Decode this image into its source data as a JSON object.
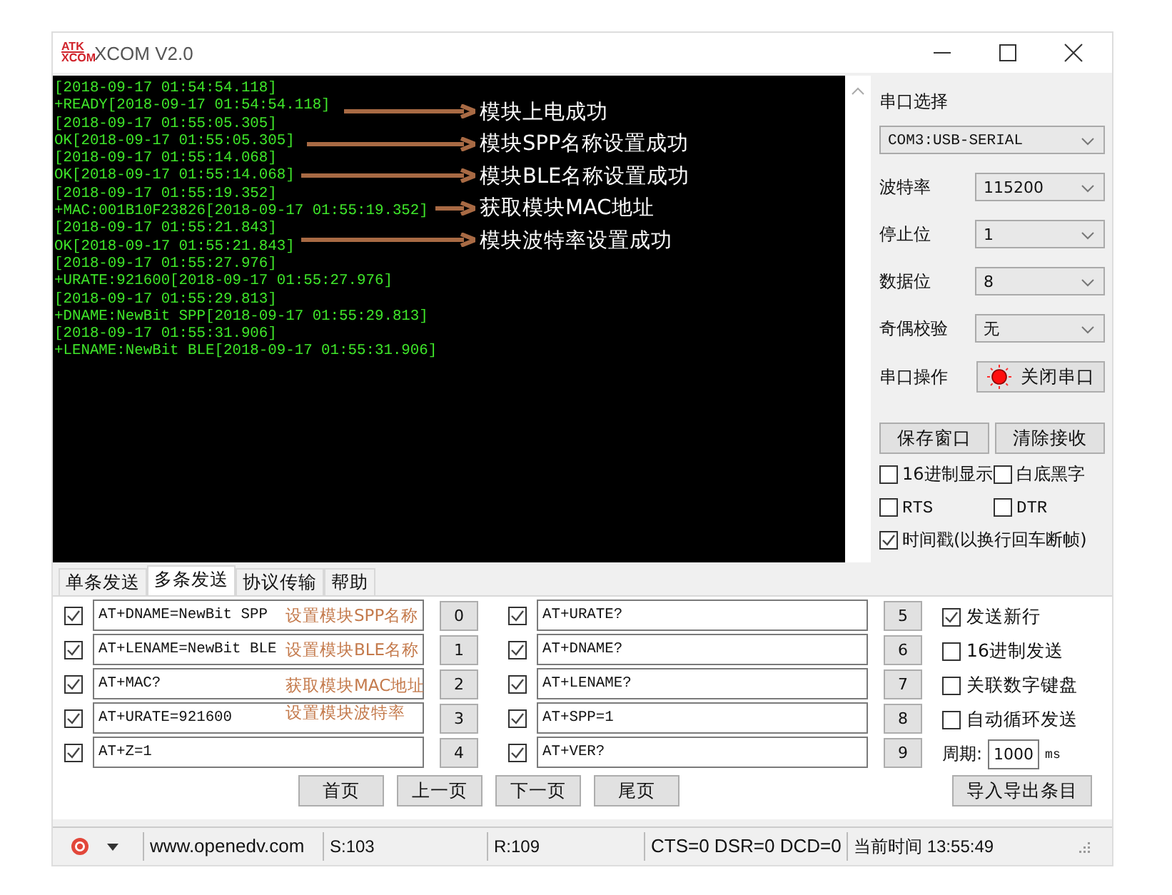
{
  "window": {
    "logo": [
      "ATK",
      "XCOM"
    ],
    "title": "XCOM V2.0"
  },
  "terminal": {
    "lines": [
      "[2018-09-17 01:54:54.118]",
      "+READY[2018-09-17 01:54:54.118]",
      "[2018-09-17 01:55:05.305]",
      "OK[2018-09-17 01:55:05.305]",
      "[2018-09-17 01:55:14.068]",
      "OK[2018-09-17 01:55:14.068]",
      "[2018-09-17 01:55:19.352]",
      "+MAC:001B10F23826[2018-09-17 01:55:19.352]",
      "[2018-09-17 01:55:21.843]",
      "OK[2018-09-17 01:55:21.843]",
      "[2018-09-17 01:55:27.976]",
      "+URATE:921600[2018-09-17 01:55:27.976]",
      "[2018-09-17 01:55:29.813]",
      "+DNAME:NewBit SPP[2018-09-17 01:55:29.813]",
      "[2018-09-17 01:55:31.906]",
      "+LENAME:NewBit BLE[2018-09-17 01:55:31.906]"
    ],
    "annotations": [
      "模块上电成功",
      "模块SPP名称设置成功",
      "模块BLE名称设置成功",
      "获取模块MAC地址",
      "模块波特率设置成功"
    ]
  },
  "port_panel": {
    "port_label": "串口选择",
    "port": "COM3:USB-SERIAL",
    "settings": [
      {
        "label": "波特率",
        "value": "115200"
      },
      {
        "label": "停止位",
        "value": "1"
      },
      {
        "label": "数据位",
        "value": "8"
      },
      {
        "label": "奇偶校验",
        "value": "无"
      }
    ],
    "operation_label": "串口操作",
    "operation_button": {
      "label": "关闭串口",
      "open": true
    },
    "buttons": [
      "保存窗口",
      "清除接收"
    ],
    "option_rows": [
      [
        {
          "label": "16进制显示",
          "checked": false
        },
        {
          "label": "白底黑字",
          "checked": false
        }
      ],
      [
        {
          "label": "RTS",
          "checked": false
        },
        {
          "label": "DTR",
          "checked": false
        }
      ],
      [
        {
          "label": "时间戳(以换行回车断帧)",
          "checked": true
        }
      ]
    ]
  },
  "send_tabs": [
    {
      "label": "单条发送",
      "selected": false
    },
    {
      "label": "多条发送",
      "selected": true
    },
    {
      "label": "协议传输",
      "selected": false
    },
    {
      "label": "帮助",
      "selected": false
    }
  ],
  "multi_send": {
    "items": [
      {
        "checked": true,
        "command": "AT+DNAME=NewBit SPP",
        "button": "0",
        "note": "设置模块SPP名称"
      },
      {
        "checked": true,
        "command": "AT+LENAME=NewBit BLE",
        "button": "1",
        "note": "设置模块BLE名称"
      },
      {
        "checked": true,
        "command": "AT+MAC?",
        "button": "2",
        "note": "获取模块MAC地址"
      },
      {
        "checked": true,
        "command": "AT+URATE=921600",
        "button": "3",
        "note": "设置模块波特率"
      },
      {
        "checked": true,
        "command": "AT+Z=1",
        "button": "4"
      },
      {
        "checked": true,
        "command": "AT+URATE?",
        "button": "5"
      },
      {
        "checked": true,
        "command": "AT+DNAME?",
        "button": "6"
      },
      {
        "checked": true,
        "command": "AT+LENAME?",
        "button": "7"
      },
      {
        "checked": true,
        "command": "AT+SPP=1",
        "button": "8"
      },
      {
        "checked": true,
        "command": "AT+VER?",
        "button": "9"
      }
    ],
    "options": [
      {
        "label": "发送新行",
        "checked": true
      },
      {
        "label": "16进制发送",
        "checked": false
      },
      {
        "label": "关联数字键盘",
        "checked": false
      },
      {
        "label": "自动循环发送",
        "checked": false
      }
    ],
    "period_label": "周期:",
    "period": "1000",
    "period_unit": "ms",
    "page_buttons": [
      "首页",
      "上一页",
      "下一页",
      "尾页"
    ],
    "import_button": "导入导出条目"
  },
  "status_bar": {
    "url": "www.openedv.com",
    "sent": "S:103",
    "received": "R:109",
    "lines": "CTS=0 DSR=0 DCD=0",
    "time": "当前时间 13:55:49"
  }
}
